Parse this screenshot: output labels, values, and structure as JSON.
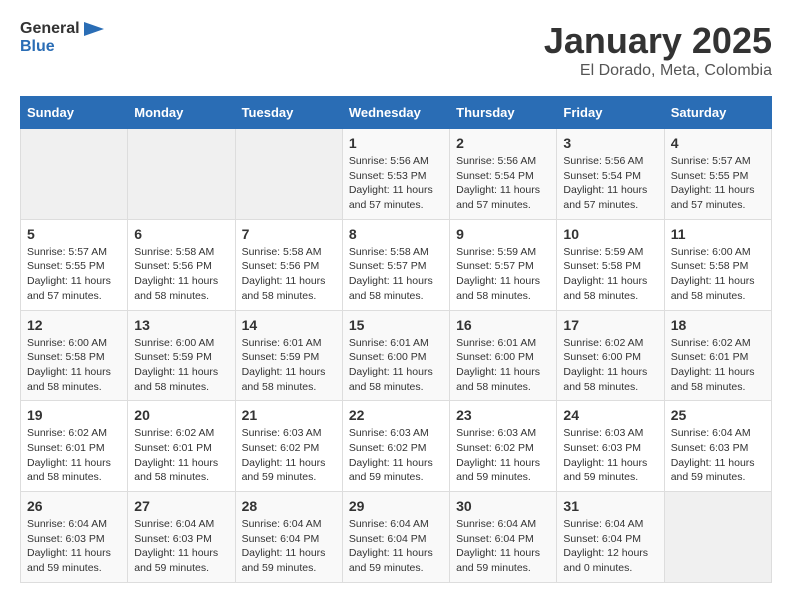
{
  "header": {
    "logo_general": "General",
    "logo_blue": "Blue",
    "title": "January 2025",
    "subtitle": "El Dorado, Meta, Colombia"
  },
  "columns": [
    "Sunday",
    "Monday",
    "Tuesday",
    "Wednesday",
    "Thursday",
    "Friday",
    "Saturday"
  ],
  "weeks": [
    [
      {
        "day": "",
        "info": ""
      },
      {
        "day": "",
        "info": ""
      },
      {
        "day": "",
        "info": ""
      },
      {
        "day": "1",
        "info": "Sunrise: 5:56 AM\nSunset: 5:53 PM\nDaylight: 11 hours and 57 minutes."
      },
      {
        "day": "2",
        "info": "Sunrise: 5:56 AM\nSunset: 5:54 PM\nDaylight: 11 hours and 57 minutes."
      },
      {
        "day": "3",
        "info": "Sunrise: 5:56 AM\nSunset: 5:54 PM\nDaylight: 11 hours and 57 minutes."
      },
      {
        "day": "4",
        "info": "Sunrise: 5:57 AM\nSunset: 5:55 PM\nDaylight: 11 hours and 57 minutes."
      }
    ],
    [
      {
        "day": "5",
        "info": "Sunrise: 5:57 AM\nSunset: 5:55 PM\nDaylight: 11 hours and 57 minutes."
      },
      {
        "day": "6",
        "info": "Sunrise: 5:58 AM\nSunset: 5:56 PM\nDaylight: 11 hours and 58 minutes."
      },
      {
        "day": "7",
        "info": "Sunrise: 5:58 AM\nSunset: 5:56 PM\nDaylight: 11 hours and 58 minutes."
      },
      {
        "day": "8",
        "info": "Sunrise: 5:58 AM\nSunset: 5:57 PM\nDaylight: 11 hours and 58 minutes."
      },
      {
        "day": "9",
        "info": "Sunrise: 5:59 AM\nSunset: 5:57 PM\nDaylight: 11 hours and 58 minutes."
      },
      {
        "day": "10",
        "info": "Sunrise: 5:59 AM\nSunset: 5:58 PM\nDaylight: 11 hours and 58 minutes."
      },
      {
        "day": "11",
        "info": "Sunrise: 6:00 AM\nSunset: 5:58 PM\nDaylight: 11 hours and 58 minutes."
      }
    ],
    [
      {
        "day": "12",
        "info": "Sunrise: 6:00 AM\nSunset: 5:58 PM\nDaylight: 11 hours and 58 minutes."
      },
      {
        "day": "13",
        "info": "Sunrise: 6:00 AM\nSunset: 5:59 PM\nDaylight: 11 hours and 58 minutes."
      },
      {
        "day": "14",
        "info": "Sunrise: 6:01 AM\nSunset: 5:59 PM\nDaylight: 11 hours and 58 minutes."
      },
      {
        "day": "15",
        "info": "Sunrise: 6:01 AM\nSunset: 6:00 PM\nDaylight: 11 hours and 58 minutes."
      },
      {
        "day": "16",
        "info": "Sunrise: 6:01 AM\nSunset: 6:00 PM\nDaylight: 11 hours and 58 minutes."
      },
      {
        "day": "17",
        "info": "Sunrise: 6:02 AM\nSunset: 6:00 PM\nDaylight: 11 hours and 58 minutes."
      },
      {
        "day": "18",
        "info": "Sunrise: 6:02 AM\nSunset: 6:01 PM\nDaylight: 11 hours and 58 minutes."
      }
    ],
    [
      {
        "day": "19",
        "info": "Sunrise: 6:02 AM\nSunset: 6:01 PM\nDaylight: 11 hours and 58 minutes."
      },
      {
        "day": "20",
        "info": "Sunrise: 6:02 AM\nSunset: 6:01 PM\nDaylight: 11 hours and 58 minutes."
      },
      {
        "day": "21",
        "info": "Sunrise: 6:03 AM\nSunset: 6:02 PM\nDaylight: 11 hours and 59 minutes."
      },
      {
        "day": "22",
        "info": "Sunrise: 6:03 AM\nSunset: 6:02 PM\nDaylight: 11 hours and 59 minutes."
      },
      {
        "day": "23",
        "info": "Sunrise: 6:03 AM\nSunset: 6:02 PM\nDaylight: 11 hours and 59 minutes."
      },
      {
        "day": "24",
        "info": "Sunrise: 6:03 AM\nSunset: 6:03 PM\nDaylight: 11 hours and 59 minutes."
      },
      {
        "day": "25",
        "info": "Sunrise: 6:04 AM\nSunset: 6:03 PM\nDaylight: 11 hours and 59 minutes."
      }
    ],
    [
      {
        "day": "26",
        "info": "Sunrise: 6:04 AM\nSunset: 6:03 PM\nDaylight: 11 hours and 59 minutes."
      },
      {
        "day": "27",
        "info": "Sunrise: 6:04 AM\nSunset: 6:03 PM\nDaylight: 11 hours and 59 minutes."
      },
      {
        "day": "28",
        "info": "Sunrise: 6:04 AM\nSunset: 6:04 PM\nDaylight: 11 hours and 59 minutes."
      },
      {
        "day": "29",
        "info": "Sunrise: 6:04 AM\nSunset: 6:04 PM\nDaylight: 11 hours and 59 minutes."
      },
      {
        "day": "30",
        "info": "Sunrise: 6:04 AM\nSunset: 6:04 PM\nDaylight: 11 hours and 59 minutes."
      },
      {
        "day": "31",
        "info": "Sunrise: 6:04 AM\nSunset: 6:04 PM\nDaylight: 12 hours and 0 minutes."
      },
      {
        "day": "",
        "info": ""
      }
    ]
  ]
}
